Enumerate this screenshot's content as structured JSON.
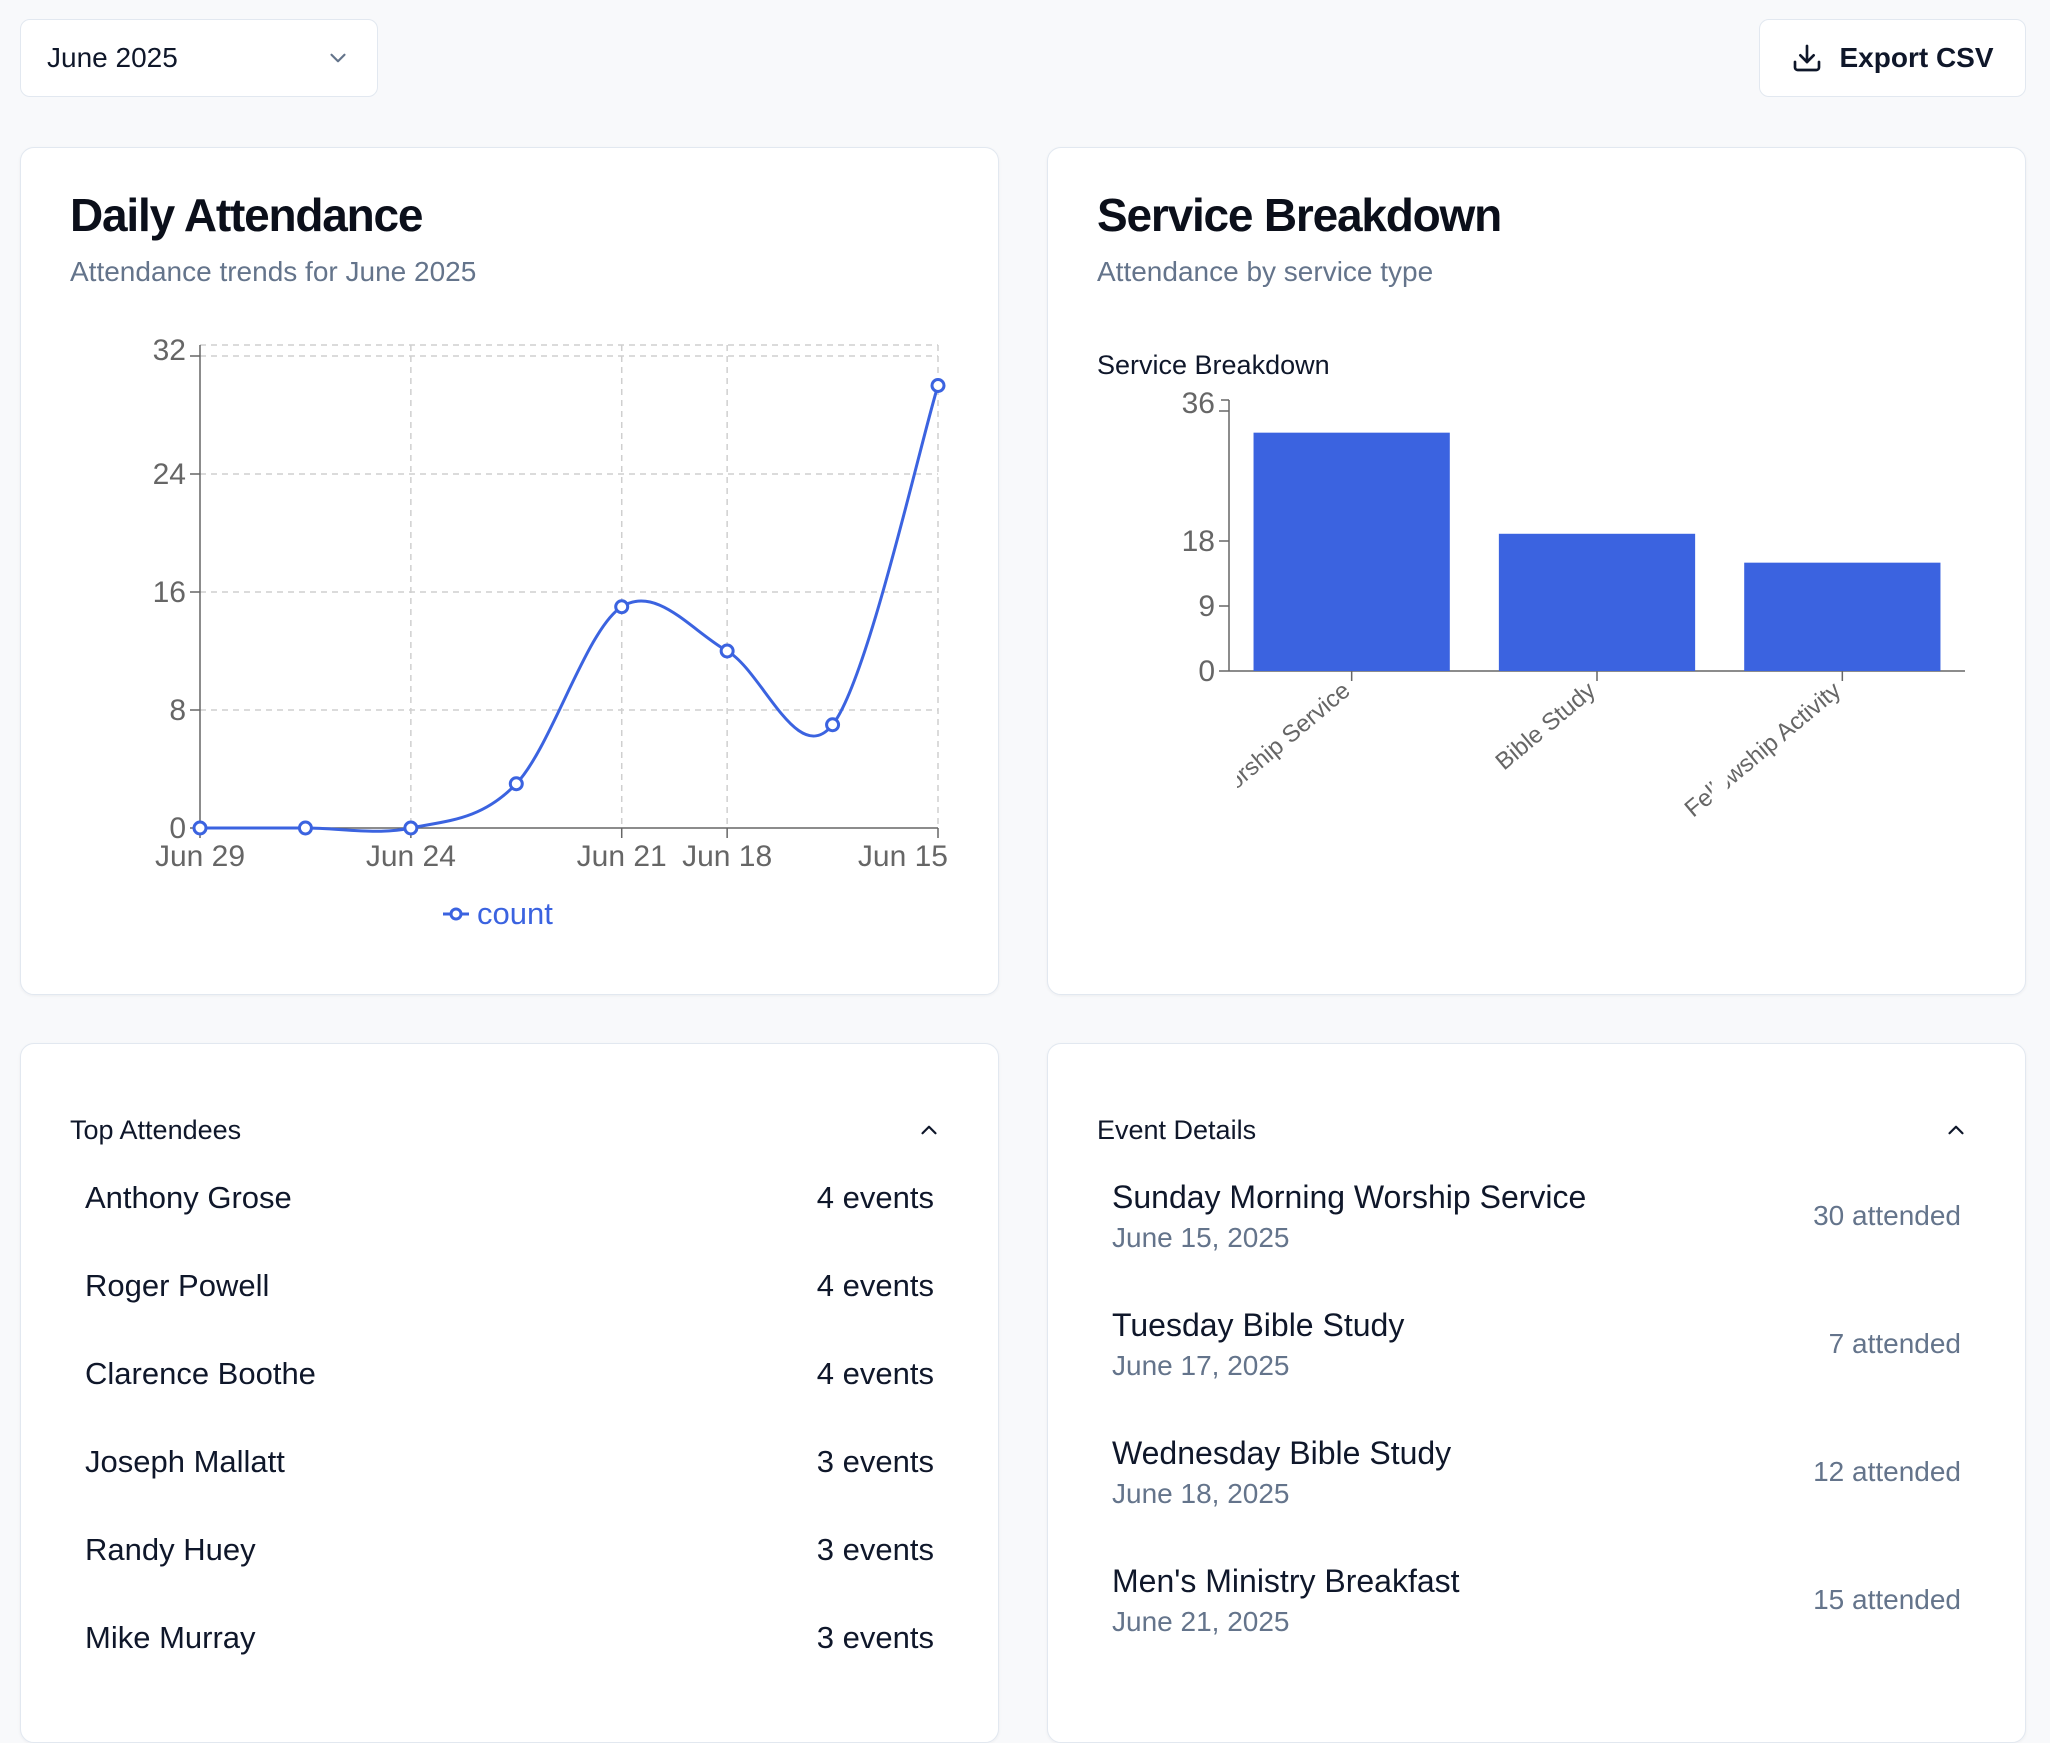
{
  "toolbar": {
    "month_select": "June 2025",
    "export_label": "Export CSV"
  },
  "daily_card": {
    "title": "Daily Attendance",
    "subtitle": "Attendance trends for June 2025"
  },
  "service_card": {
    "title": "Service Breakdown",
    "subtitle": "Attendance by service type"
  },
  "top_attendees": {
    "title": "Top Attendees",
    "items": [
      {
        "name": "Anthony Grose",
        "count": "4 events"
      },
      {
        "name": "Roger Powell",
        "count": "4 events"
      },
      {
        "name": "Clarence Boothe",
        "count": "4 events"
      },
      {
        "name": "Joseph Mallatt",
        "count": "3 events"
      },
      {
        "name": "Randy Huey",
        "count": "3 events"
      },
      {
        "name": "Mike Murray",
        "count": "3 events"
      }
    ]
  },
  "event_details": {
    "title": "Event Details",
    "items": [
      {
        "name": "Sunday Morning Worship Service",
        "date": "June 15, 2025",
        "count": "30 attended"
      },
      {
        "name": "Tuesday Bible Study",
        "date": "June 17, 2025",
        "count": "7 attended"
      },
      {
        "name": "Wednesday Bible Study",
        "date": "June 18, 2025",
        "count": "12 attended"
      },
      {
        "name": "Men's Ministry Breakfast",
        "date": "June 21, 2025",
        "count": "15 attended"
      }
    ]
  },
  "chart_data": [
    {
      "type": "line",
      "curve": "smooth",
      "color": "#3b63e0",
      "x_ticks": [
        "Jun 29",
        "Jun 24",
        "Jun 21",
        "Jun 18",
        "Jun 15"
      ],
      "y_ticks": [
        0,
        8,
        16,
        24,
        32
      ],
      "ylim": [
        0,
        32
      ],
      "grid": true,
      "legend": "bottom",
      "series": [
        {
          "name": "count",
          "points": [
            {
              "x": "Jun 29",
              "y": 0
            },
            {
              "x": "",
              "y": 0
            },
            {
              "x": "Jun 24",
              "y": 0
            },
            {
              "x": "",
              "y": 3
            },
            {
              "x": "Jun 21",
              "y": 15
            },
            {
              "x": "Jun 18",
              "y": 12
            },
            {
              "x": "",
              "y": 7
            },
            {
              "x": "Jun 15",
              "y": 30
            }
          ]
        }
      ]
    },
    {
      "type": "bar",
      "title": "Service Breakdown",
      "color": "#3b63e0",
      "categories": [
        "Worship Service",
        "Bible Study",
        "Fellowship Activity"
      ],
      "values": [
        33,
        19,
        15
      ],
      "y_ticks": [
        0,
        9,
        18,
        36
      ],
      "ylim": [
        0,
        36
      ]
    }
  ]
}
